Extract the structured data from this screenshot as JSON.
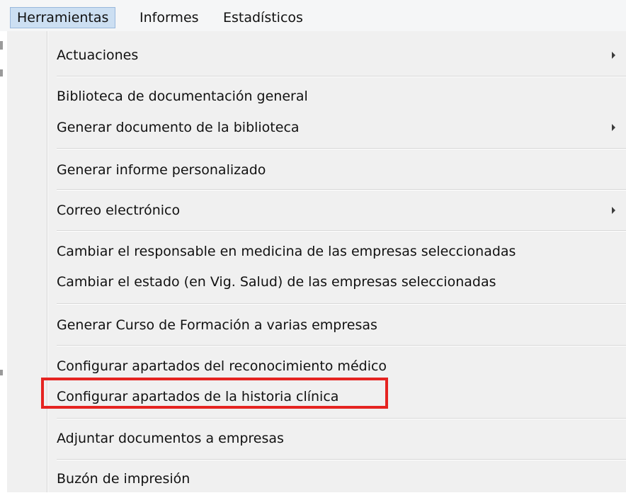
{
  "menubar": {
    "items": [
      "Herramientas",
      "Informes",
      "Estadísticos"
    ]
  },
  "dropdown": {
    "items": [
      "Actuaciones",
      "Biblioteca de documentación general",
      "Generar documento de la biblioteca",
      "Generar informe personalizado",
      "Correo electrónico",
      "Cambiar el responsable en medicina de las empresas seleccionadas",
      "Cambiar el estado (en Vig. Salud) de las empresas seleccionadas",
      "Generar Curso de Formación a varias empresas",
      "Configurar apartados del reconocimiento médico",
      "Configurar apartados de la historia clínica",
      "Adjuntar documentos a empresas",
      "Buzón de impresión"
    ],
    "highlighted_item": "Configurar apartados de la historia clínica"
  },
  "colors": {
    "highlight_border": "#e52421",
    "active_menu_bg": "#ccdff2",
    "menu_bg": "#f0f0f0"
  }
}
